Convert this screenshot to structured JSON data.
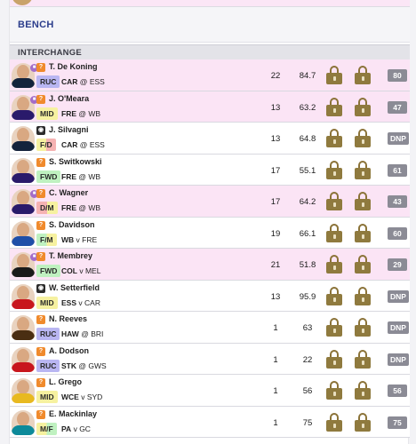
{
  "bench_label": "BENCH",
  "interchange_label": "INTERCHANGE",
  "rows": [
    {
      "name": "T. De Koning",
      "pos": "RUC",
      "pos_class": "RUC",
      "team": "CAR",
      "sep": "@",
      "opp": "ESS",
      "rounds": "22",
      "avg": "84.7",
      "score": "80",
      "bg": "pink",
      "shirt": "#14233c",
      "status": "injury"
    },
    {
      "name": "J. O'Meara",
      "pos": "MID",
      "pos_class": "MID",
      "team": "FRE",
      "sep": "@",
      "opp": "WB",
      "rounds": "13",
      "avg": "63.2",
      "score": "47",
      "bg": "pink",
      "shirt": "#2a1a6b",
      "status": "injury"
    },
    {
      "name": "J. Silvagni",
      "pos": "F/D",
      "pos_class": "FD",
      "team": "CAR",
      "sep": "@",
      "opp": "ESS",
      "rounds": "13",
      "avg": "64.8",
      "score": "DNP",
      "bg": "white",
      "shirt": "#14233c",
      "status": "camera"
    },
    {
      "name": "S. Switkowski",
      "pos": "FWD",
      "pos_class": "FWD",
      "team": "FRE",
      "sep": "@",
      "opp": "WB",
      "rounds": "17",
      "avg": "55.1",
      "score": "61",
      "bg": "white",
      "shirt": "#2a1a6b",
      "status": "info"
    },
    {
      "name": "C. Wagner",
      "pos": "D/M",
      "pos_class": "DM",
      "team": "FRE",
      "sep": "@",
      "opp": "WB",
      "rounds": "17",
      "avg": "64.2",
      "score": "43",
      "bg": "pink",
      "shirt": "#2a1a6b",
      "status": "injury"
    },
    {
      "name": "S. Davidson",
      "pos": "F/M",
      "pos_class": "FM",
      "team": "WB",
      "sep": "v",
      "opp": "FRE",
      "rounds": "19",
      "avg": "66.1",
      "score": "60",
      "bg": "white",
      "shirt": "#1f4fa8",
      "status": "info"
    },
    {
      "name": "T. Membrey",
      "pos": "FWD",
      "pos_class": "FWD",
      "team": "COL",
      "sep": "v",
      "opp": "MEL",
      "rounds": "21",
      "avg": "51.8",
      "score": "29",
      "bg": "pink",
      "shirt": "#1a1a1a",
      "status": "injury"
    },
    {
      "name": "W. Setterfield",
      "pos": "MID",
      "pos_class": "MID",
      "team": "ESS",
      "sep": "v",
      "opp": "CAR",
      "rounds": "13",
      "avg": "95.9",
      "score": "DNP",
      "bg": "white",
      "shirt": "#c8161d",
      "status": "camera"
    },
    {
      "name": "N. Reeves",
      "pos": "RUC",
      "pos_class": "RUC",
      "team": "HAW",
      "sep": "@",
      "opp": "BRI",
      "rounds": "1",
      "avg": "63",
      "score": "DNP",
      "bg": "white",
      "shirt": "#4a2e12",
      "status": "info"
    },
    {
      "name": "A. Dodson",
      "pos": "RUC",
      "pos_class": "RUC",
      "team": "STK",
      "sep": "@",
      "opp": "GWS",
      "rounds": "1",
      "avg": "22",
      "score": "DNP",
      "bg": "white",
      "shirt": "#c8161d",
      "status": "info"
    },
    {
      "name": "L. Grego",
      "pos": "MID",
      "pos_class": "MID",
      "team": "WCE",
      "sep": "v",
      "opp": "SYD",
      "rounds": "1",
      "avg": "56",
      "score": "56",
      "bg": "white",
      "shirt": "#e8b920",
      "status": "info"
    },
    {
      "name": "E. Mackinlay",
      "pos": "M/F",
      "pos_class": "MF",
      "team": "PA",
      "sep": "v",
      "opp": "GC",
      "rounds": "1",
      "avg": "75",
      "score": "75",
      "bg": "white",
      "shirt": "#0d8a9a",
      "status": "info"
    }
  ]
}
